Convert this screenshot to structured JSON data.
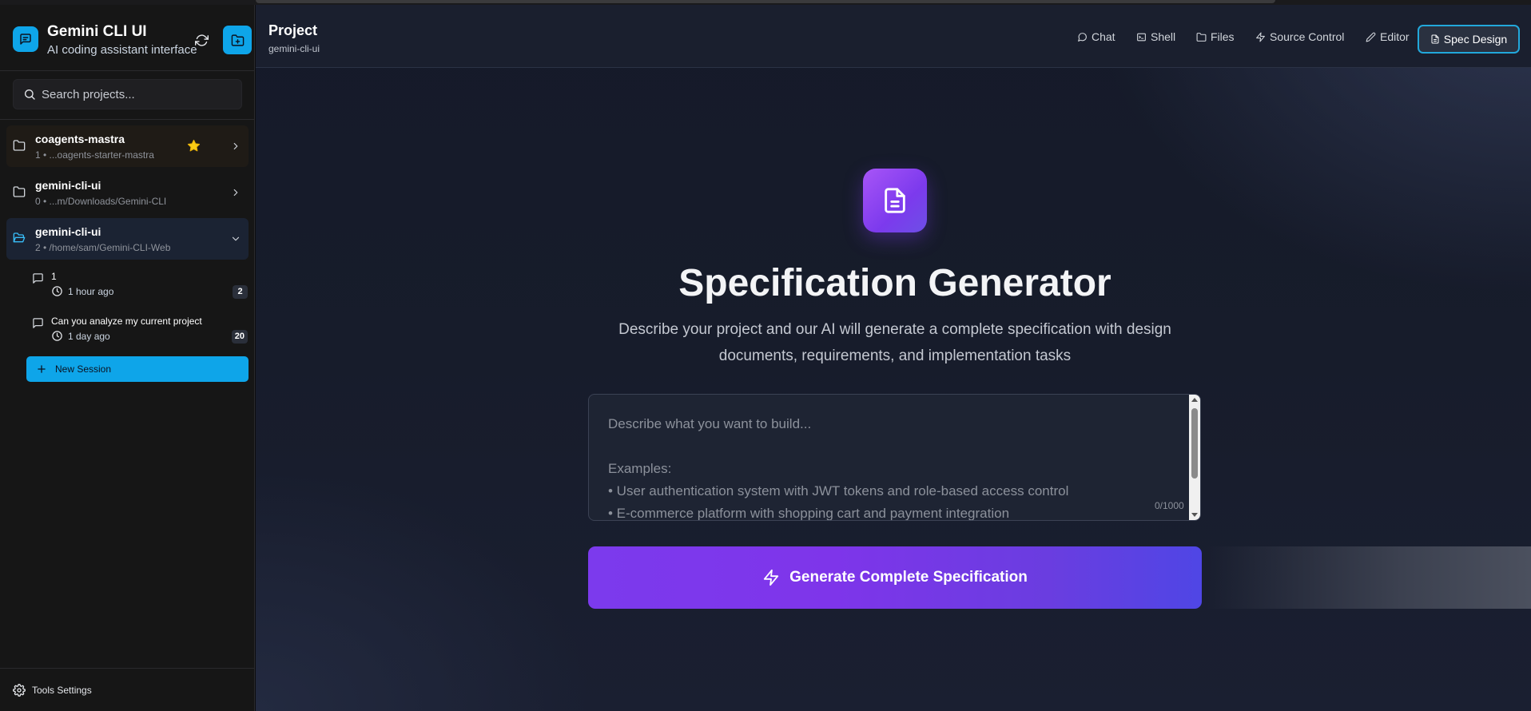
{
  "sidebar": {
    "app_title": "Gemini CLI UI",
    "app_subtitle": "AI coding assistant interface",
    "search_placeholder": "Search projects...",
    "projects": [
      {
        "name": "coagents-mastra",
        "meta": "1 • ...oagents-starter-mastra",
        "starred": true,
        "expanded": false
      },
      {
        "name": "gemini-cli-ui",
        "meta": "0 • ...m/Downloads/Gemini-CLI",
        "starred": false,
        "expanded": false
      },
      {
        "name": "gemini-cli-ui",
        "meta": "2 • /home/sam/Gemini-CLI-Web",
        "starred": false,
        "expanded": true
      }
    ],
    "sessions": [
      {
        "title": "1",
        "time": "1 hour ago",
        "count": "2"
      },
      {
        "title": "Can you analyze my current project",
        "time": "1 day ago",
        "count": "20"
      }
    ],
    "new_session_label": "New Session",
    "tools_settings_label": "Tools Settings"
  },
  "header": {
    "title": "Project",
    "subtitle": "gemini-cli-ui",
    "tabs": [
      {
        "label": "Chat",
        "icon": "chat-icon"
      },
      {
        "label": "Shell",
        "icon": "terminal-icon"
      },
      {
        "label": "Files",
        "icon": "folder-icon"
      },
      {
        "label": "Source Control",
        "icon": "lightning-icon"
      },
      {
        "label": "Editor",
        "icon": "pencil-icon"
      },
      {
        "label": "Spec Design",
        "icon": "document-icon",
        "active": true
      }
    ]
  },
  "main": {
    "hero_title": "Specification Generator",
    "hero_description": "Describe your project and our AI will generate a complete specification with design documents, requirements, and implementation tasks",
    "textarea_placeholder": "Describe what you want to build...\n\nExamples:\n• User authentication system with JWT tokens and role-based access control\n• E-commerce platform with shopping cart and payment integration",
    "char_counter": "0/1000",
    "generate_button_label": "Generate Complete Specification"
  },
  "colors": {
    "accent": "#0ea5e9",
    "primary_gradient_start": "#7c3aed",
    "primary_gradient_end": "#4f46e5",
    "star": "#facc15"
  }
}
